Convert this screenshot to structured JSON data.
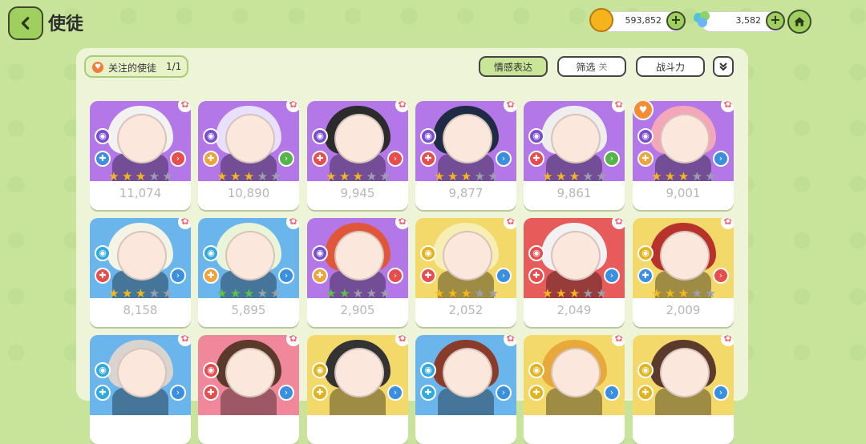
{
  "header": {
    "title": "使徒"
  },
  "resources": [
    {
      "name": "coin",
      "value": "593,852",
      "icon": "coin-icon",
      "color": "#f5b41b"
    },
    {
      "name": "gem",
      "value": "3,582",
      "icon": "flower-gem-icon",
      "color": "#4fc3d9"
    }
  ],
  "toolbar": {
    "favorites_label": "关注的使徒",
    "favorites_count": "1/1",
    "emotion_label": "情感表达",
    "filter_label": "筛选",
    "filter_state": "关",
    "power_label": "战斗力",
    "expand_icon": "double-chevron-down-icon"
  },
  "heroes": [
    {
      "power": "11,074",
      "bg": "purple",
      "stars": {
        "type": "gold",
        "count": 3
      },
      "hair": "#f2f2f2",
      "elem": "#7a4bd3",
      "cls": "#3a8fe0",
      "pos": "#e84c4c",
      "favorite": false
    },
    {
      "power": "10,890",
      "bg": "purple",
      "stars": {
        "type": "gold",
        "count": 3
      },
      "hair": "#e8e0ff",
      "elem": "#7a4bd3",
      "cls": "#f2a23a",
      "pos": "#53b54a",
      "favorite": false
    },
    {
      "power": "9,945",
      "bg": "purple",
      "stars": {
        "type": "gold",
        "count": 3
      },
      "hair": "#2b2b2b",
      "elem": "#7a4bd3",
      "cls": "#e84c4c",
      "pos": "#e84c4c",
      "favorite": false
    },
    {
      "power": "9,877",
      "bg": "purple",
      "stars": {
        "type": "gold",
        "count": 3
      },
      "hair": "#1f2a44",
      "elem": "#7a4bd3",
      "cls": "#e84c4c",
      "pos": "#3a8fe0",
      "favorite": false
    },
    {
      "power": "9,861",
      "bg": "purple",
      "stars": {
        "type": "gold",
        "count": 3
      },
      "hair": "#eeeeee",
      "elem": "#7a4bd3",
      "cls": "#e84c4c",
      "pos": "#53b54a",
      "favorite": false
    },
    {
      "power": "9,001",
      "bg": "purple",
      "stars": {
        "type": "gold",
        "count": 3
      },
      "hair": "#f4a7b9",
      "elem": "#7a4bd3",
      "cls": "#f2a23a",
      "pos": "#3a8fe0",
      "favorite": true
    },
    {
      "power": "8,158",
      "bg": "blue",
      "stars": {
        "type": "gold",
        "count": 3
      },
      "hair": "#f4f4e6",
      "elem": "#2fa9e0",
      "cls": "#e84c4c",
      "pos": "#3a8fe0",
      "favorite": false
    },
    {
      "power": "5,895",
      "bg": "blue",
      "stars": {
        "type": "green",
        "count": 3
      },
      "hair": "#e9f4d9",
      "elem": "#2fa9e0",
      "cls": "#f2a23a",
      "pos": "#3a8fe0",
      "favorite": false
    },
    {
      "power": "2,905",
      "bg": "purple",
      "stars": {
        "type": "green",
        "count": 2
      },
      "hair": "#e0563a",
      "elem": "#7a4bd3",
      "cls": "#f2a23a",
      "pos": "#e84c4c",
      "favorite": false
    },
    {
      "power": "2,052",
      "bg": "yellow",
      "stars": {
        "type": "gold",
        "count": 3
      },
      "hair": "#f6eeb3",
      "elem": "#e3b21c",
      "cls": "#e84c4c",
      "pos": "#3a8fe0",
      "favorite": false
    },
    {
      "power": "2,049",
      "bg": "red",
      "stars": {
        "type": "gold",
        "count": 3
      },
      "hair": "#f2f2f2",
      "elem": "#e84c4c",
      "cls": "#e84c4c",
      "pos": "#3a8fe0",
      "favorite": false
    },
    {
      "power": "2,009",
      "bg": "yellow",
      "stars": {
        "type": "gold",
        "count": 3
      },
      "hair": "#b6322b",
      "elem": "#e3b21c",
      "cls": "#3a8fe0",
      "pos": "#e84c4c",
      "favorite": false
    },
    {
      "power": "",
      "bg": "blue",
      "stars": {
        "type": "gold",
        "count": 0
      },
      "hair": "#d9d4cf",
      "elem": "#2fa9e0",
      "cls": "#2fa9e0",
      "pos": "#3a8fe0",
      "favorite": false
    },
    {
      "power": "",
      "bg": "pink",
      "stars": {
        "type": "gold",
        "count": 0
      },
      "hair": "#5b3a2c",
      "elem": "#e84c4c",
      "cls": "#e84c4c",
      "pos": "#3a8fe0",
      "favorite": false
    },
    {
      "power": "",
      "bg": "yellow",
      "stars": {
        "type": "gold",
        "count": 0
      },
      "hair": "#333333",
      "elem": "#e3b21c",
      "cls": "#e3b21c",
      "pos": "#3a8fe0",
      "favorite": false
    },
    {
      "power": "",
      "bg": "blue",
      "stars": {
        "type": "gold",
        "count": 0
      },
      "hair": "#8a3c2a",
      "elem": "#2fa9e0",
      "cls": "#2fa9e0",
      "pos": "#3a8fe0",
      "favorite": false
    },
    {
      "power": "",
      "bg": "yellow",
      "stars": {
        "type": "gold",
        "count": 0
      },
      "hair": "#e9a93a",
      "elem": "#e3b21c",
      "cls": "#e3b21c",
      "pos": "#3a8fe0",
      "favorite": false
    },
    {
      "power": "",
      "bg": "yellow",
      "stars": {
        "type": "gold",
        "count": 0
      },
      "hair": "#5b3a2c",
      "elem": "#e3b21c",
      "cls": "#e3b21c",
      "pos": "#3a8fe0",
      "favorite": false
    }
  ]
}
